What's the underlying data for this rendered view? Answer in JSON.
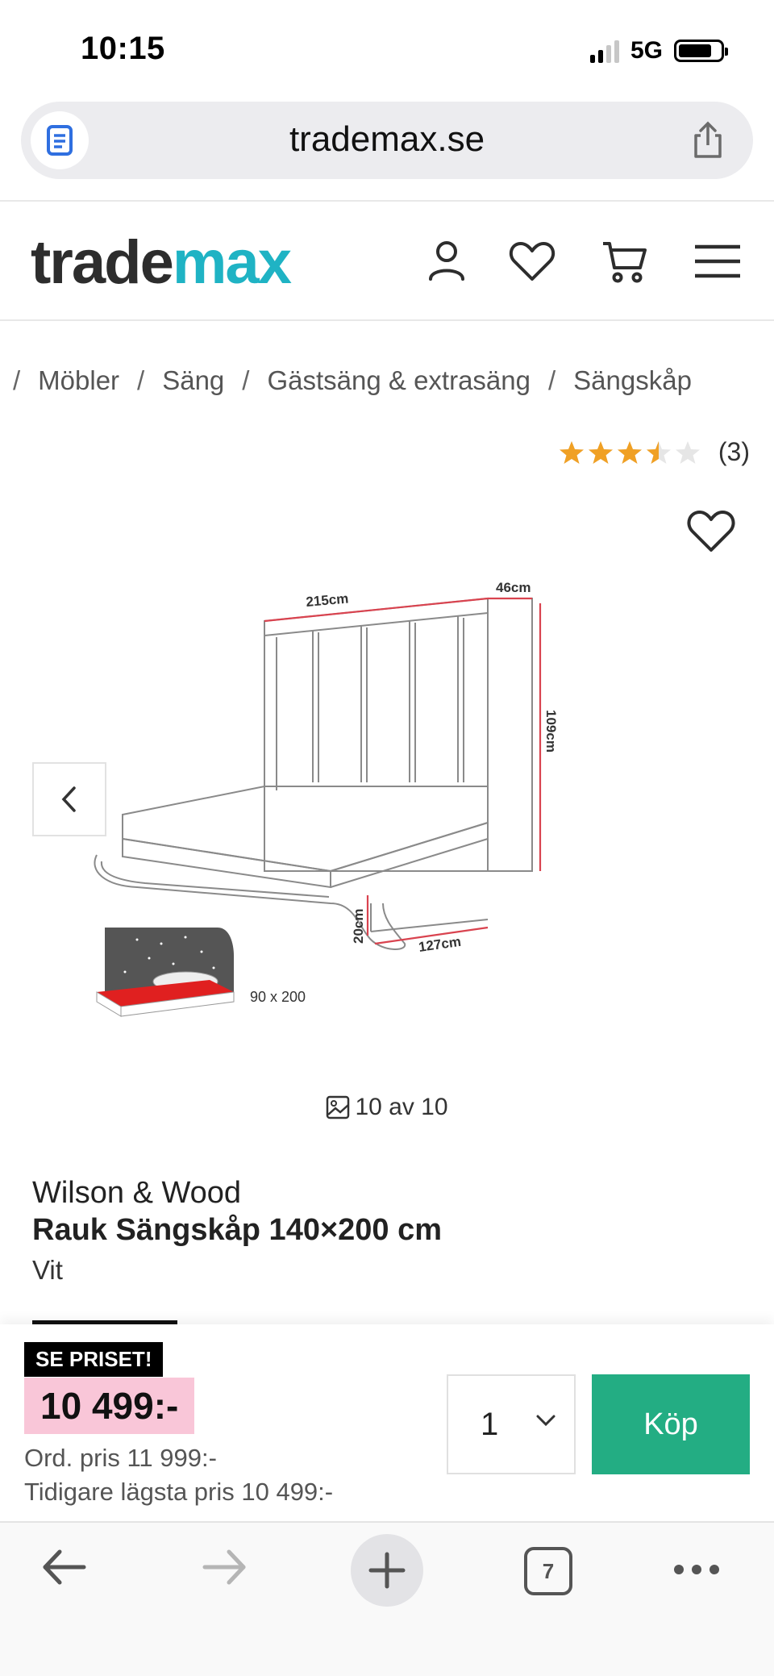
{
  "status_bar": {
    "time": "10:15",
    "network": "5G"
  },
  "browser": {
    "url": "trademax.se",
    "reader_icon": "reader-icon",
    "share_icon": "share-icon"
  },
  "header": {
    "logo_part1": "trade",
    "logo_part2": "max",
    "logo_accent_color": "#1fb3c4",
    "icons": [
      "account-icon",
      "heart-icon",
      "cart-icon",
      "menu-icon"
    ]
  },
  "breadcrumb": {
    "items": [
      "Möbler",
      "Säng",
      "Gästsäng & extrasäng",
      "Sängskåp"
    ]
  },
  "rating": {
    "stars": 3.5,
    "max": 5,
    "count": "(3)",
    "star_color": "#f0a024"
  },
  "gallery": {
    "counter": "10 av 10",
    "dim_width": "215cm",
    "dim_depth": "46cm",
    "dim_height": "109cm",
    "dim_leg": "20cm",
    "dim_open": "127cm",
    "inset_size": "90 x 200"
  },
  "product": {
    "brand": "Wilson & Wood",
    "name": "Rauk Sängskåp 140×200 cm",
    "variant": "Vit"
  },
  "buy": {
    "badge": "SE PRISET!",
    "price": "10 499:-",
    "ord_price": "Ord. pris 11 999:-",
    "lowest_price": "Tidigare lägsta pris 10 499:-",
    "quantity": "1",
    "buy_label": "Köp",
    "buy_color": "#23ad83",
    "price_bg": "#f9c6d8"
  },
  "toolbar": {
    "tabs_count": "7"
  }
}
